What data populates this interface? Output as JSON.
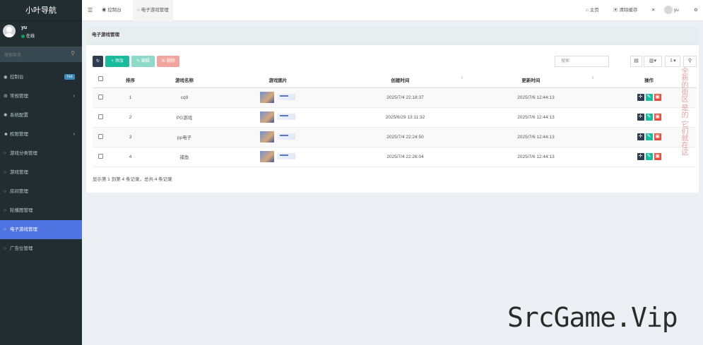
{
  "sidebar": {
    "logo": "小叶导航",
    "user": {
      "name": "yu",
      "status": "在线"
    },
    "search_placeholder": "搜索菜单",
    "items": [
      {
        "icon": "dashboard-icon",
        "glyph": "◉",
        "label": "控制台",
        "badge": "hot"
      },
      {
        "icon": "cogs-icon",
        "glyph": "⚙",
        "label": "常规管理",
        "arrow": "‹"
      },
      {
        "icon": "gear-icon",
        "glyph": "✱",
        "label": "系统配置"
      },
      {
        "icon": "group-icon",
        "glyph": "☻",
        "label": "权限管理",
        "arrow": "‹"
      },
      {
        "icon": "circle-icon",
        "glyph": "○",
        "label": "游戏分类管理"
      },
      {
        "icon": "circle-icon",
        "glyph": "○",
        "label": "游戏管理"
      },
      {
        "icon": "circle-icon",
        "glyph": "○",
        "label": "房间管理"
      },
      {
        "icon": "circle-icon",
        "glyph": "○",
        "label": "轮播图管理"
      },
      {
        "icon": "circle-icon",
        "glyph": "○",
        "label": "电子游戏管理",
        "active": true
      },
      {
        "icon": "circle-icon",
        "glyph": "○",
        "label": "广告位管理"
      }
    ]
  },
  "topbar": {
    "tabs": [
      {
        "label": "控制台",
        "icon": "dashboard-icon"
      },
      {
        "label": "电子游戏管理",
        "icon": "circle-icon",
        "active": true
      }
    ],
    "home": "主页",
    "clear_cache": "清除缓存",
    "username": "yu"
  },
  "panel": {
    "title": "电子游戏管理",
    "buttons": {
      "add": "添加",
      "edit": "编辑",
      "delete": "删除"
    },
    "search_placeholder": "搜索",
    "columns": [
      "排序",
      "游戏名称",
      "游戏图片",
      "创建时间",
      "更新时间",
      "操作"
    ],
    "rows": [
      {
        "sort": "1",
        "name": "cq9",
        "created": "2025/7/4 22:18:37",
        "updated": "2025/7/6 12:44:13"
      },
      {
        "sort": "2",
        "name": "PG游戏",
        "created": "2025/6/29 13:11:32",
        "updated": "2025/7/6 12:44:13"
      },
      {
        "sort": "3",
        "name": "pp电子",
        "created": "2025/7/4 22:24:50",
        "updated": "2025/7/6 12:44:13"
      },
      {
        "sort": "4",
        "name": "捕鱼",
        "created": "2025/7/4 22:26:04",
        "updated": "2025/7/6 12:44:13"
      }
    ],
    "footer": "显示第 1 到第 4 条记录，总共 4 条记录"
  },
  "watermark": {
    "vertical": "全新的街区 是的 它们就在这",
    "brand": "SrcGame.Vip"
  },
  "colors": {
    "sidebar_bg": "#222d32",
    "active": "#4f73e0",
    "success": "#18bc9c",
    "danger": "#e74c3c"
  }
}
